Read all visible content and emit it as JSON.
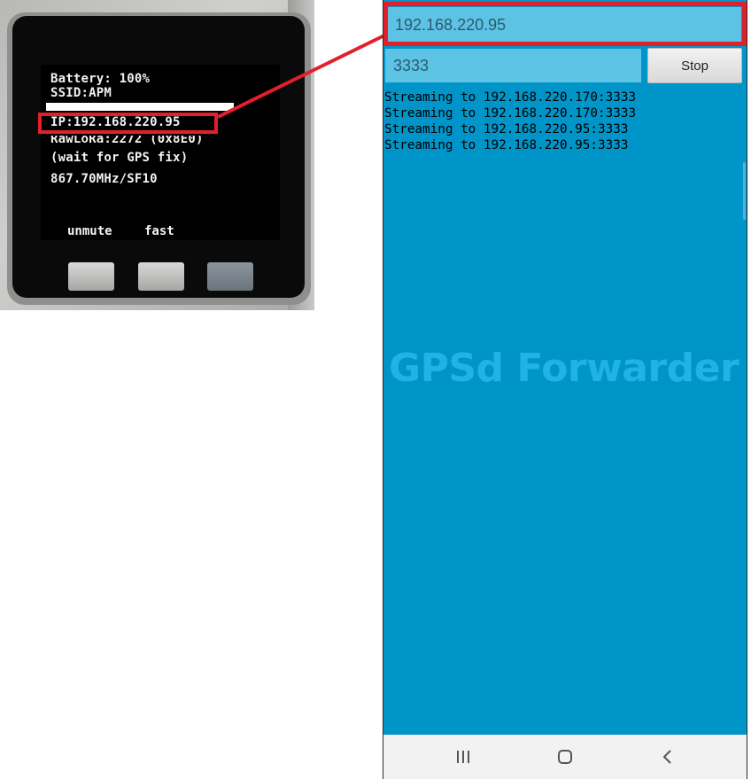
{
  "device": {
    "screen_lines": [
      "Battery: 100%",
      "SSID:APM",
      "IP:192.168.220.95",
      "RawLoRa:2272 (0x8E0)",
      "(wait for GPS fix)",
      "867.70MHz/SF10"
    ],
    "softkeys": [
      "unmute",
      "fast"
    ]
  },
  "app": {
    "ip_value": "192.168.220.95",
    "port_value": "3333",
    "stop_label": "Stop",
    "log": [
      "Streaming to 192.168.220.170:3333",
      "Streaming to 192.168.220.170:3333",
      "Streaming to 192.168.220.95:3333",
      "Streaming to 192.168.220.95:3333"
    ],
    "watermark": "GPSd Forwarder"
  },
  "nav": {
    "icons": [
      "recent-apps-icon",
      "home-icon",
      "back-icon"
    ]
  },
  "colors": {
    "app_background": "#0095c8",
    "input_background": "#5cc3e4",
    "highlight": "#e2202a",
    "watermark": "#1fb3e6"
  }
}
